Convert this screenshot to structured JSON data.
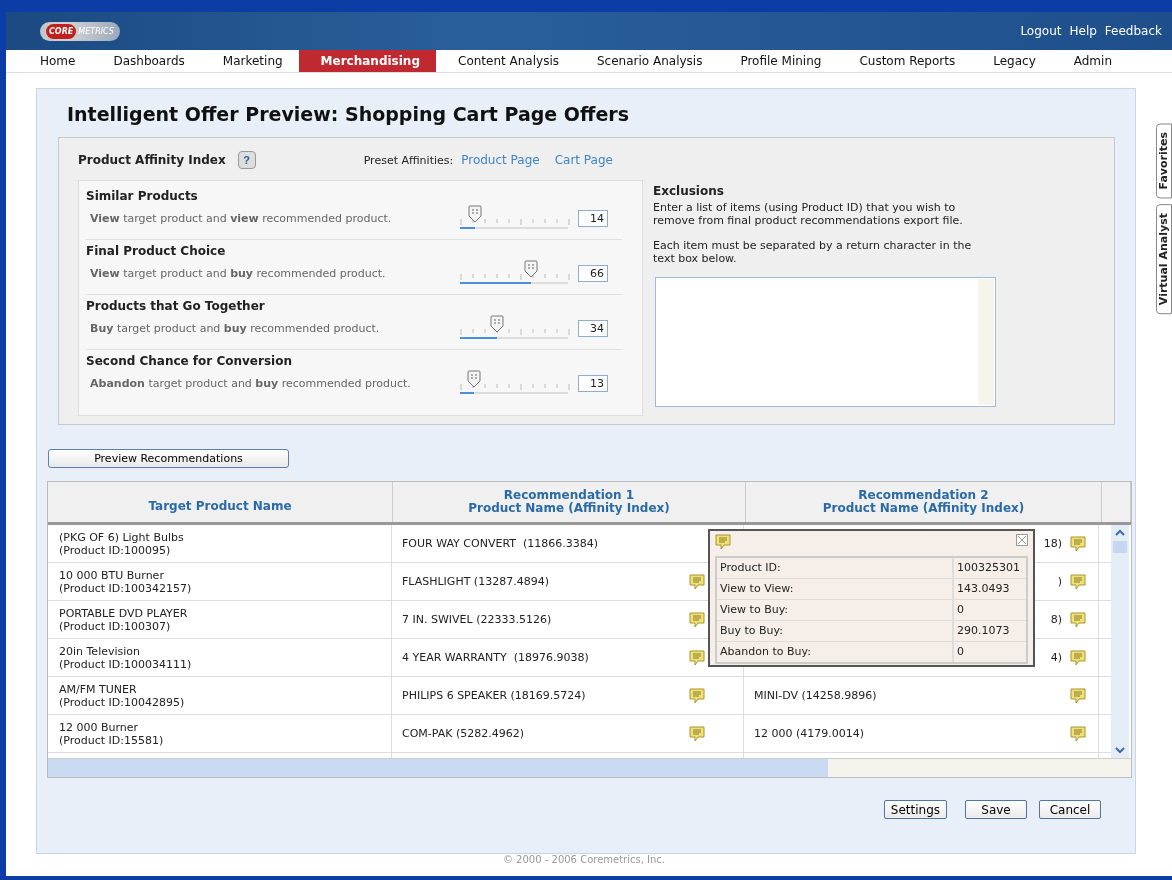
{
  "header": {
    "logo": {
      "mark": "CORE",
      "word": "METRICS"
    },
    "links": [
      "Logout",
      "Help",
      "Feedback"
    ]
  },
  "nav": [
    {
      "label": "Home",
      "selected": false
    },
    {
      "label": "Dashboards",
      "selected": false
    },
    {
      "label": "Marketing",
      "selected": false
    },
    {
      "label": "Merchandising",
      "selected": true
    },
    {
      "label": "Content Analysis",
      "selected": false
    },
    {
      "label": "Scenario Analysis",
      "selected": false
    },
    {
      "label": "Profile Mining",
      "selected": false
    },
    {
      "label": "Custom Reports",
      "selected": false
    },
    {
      "label": "Legacy",
      "selected": false
    },
    {
      "label": "Admin",
      "selected": false
    }
  ],
  "side_tabs": [
    "Favorites",
    "Virtual Analyst"
  ],
  "page_title": "Intelligent Offer Preview: Shopping Cart Page Offers",
  "affinity": {
    "title": "Product Affinity Index",
    "help": "?",
    "preset_label": "Preset Affinities:",
    "presets": [
      "Product Page",
      "Cart Page"
    ],
    "sliders": [
      {
        "name": "Similar Products",
        "description": "**View** target product and **view** recommended product.",
        "level": 0.14,
        "value": "14"
      },
      {
        "name": "Final Product Choice",
        "description": "**View** target product and **buy** recommended product.",
        "level": 0.66,
        "value": "66"
      },
      {
        "name": "Products that Go Together",
        "description": "**Buy** target product and **buy** recommended product.",
        "level": 0.34,
        "value": "34"
      },
      {
        "name": "Second Chance for Conversion",
        "description": "**Abandon** target product and **buy** recommended product.",
        "level": 0.13,
        "value": "13"
      }
    ]
  },
  "exclusions": {
    "title": "Exclusions",
    "text": [
      "Enter a list of items (using Product ID) that you wish to remove from final product recommendations export file.",
      "Each item must be separated by a return character in the text box below."
    ]
  },
  "preview_button": "Preview Recommendations",
  "table": {
    "columns": [
      "Target Product Name",
      [
        "Recommendation 1",
        "Product Name (Affinity Index)"
      ],
      [
        "Recommendation 2",
        "Product Name (Affinity Index)"
      ]
    ],
    "rows": [
      {
        "target": [
          "(PKG OF 6)  Light Bulbs",
          "(Product ID:100095)"
        ],
        "rec1": {
          "text": "FOUR WAY CONVERT  (11866.3384)",
          "note": false
        },
        "rec2": {
          "text": "18)",
          "note": true
        }
      },
      {
        "target": [
          "10 000 BTU Burner",
          "(Product ID:100342157)"
        ],
        "rec1": {
          "text": "FLASHLIGHT (13287.4894)",
          "note": true
        },
        "rec2": {
          "text": ")",
          "note": true
        }
      },
      {
        "target": [
          "PORTABLE DVD PLAYER",
          "(Product ID:100307)"
        ],
        "rec1": {
          "text": "7 IN. SWIVEL (22333.5126)",
          "note": true
        },
        "rec2": {
          "text": "8)",
          "note": true
        }
      },
      {
        "target": [
          "20in Television",
          "(Product ID:100034111)"
        ],
        "rec1": {
          "text": "4 YEAR WARRANTY  (18976.9038)",
          "note": true
        },
        "rec2": {
          "text": "4)",
          "note": true
        }
      },
      {
        "target": [
          "AM/FM TUNER",
          "(Product ID:10042895)"
        ],
        "rec1": {
          "text": "PHILIPS 6 SPEAKER (18169.5724)",
          "note": true
        },
        "rec2": {
          "text": "MINI-DV (14258.9896)",
          "note": true
        }
      },
      {
        "target": [
          "12 000 Burner",
          "(Product ID:15581)"
        ],
        "rec1": {
          "text": "COM-PAK (5282.4962)",
          "note": true
        },
        "rec2": {
          "text": "12 000 (4179.0014)",
          "note": true
        }
      }
    ]
  },
  "popup": {
    "rows": [
      {
        "label": "Product ID:",
        "value": "100325301"
      },
      {
        "label": "View to View:",
        "value": "143.0493"
      },
      {
        "label": "View to Buy:",
        "value": "0"
      },
      {
        "label": "Buy to Buy:",
        "value": "290.1073"
      },
      {
        "label": "Abandon to Buy:",
        "value": "0"
      }
    ]
  },
  "buttons": [
    "Settings",
    "Save",
    "Cancel"
  ],
  "footer": "© 2000 - 2006 Coremetrics, Inc."
}
